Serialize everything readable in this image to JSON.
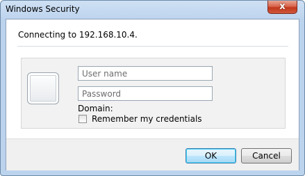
{
  "window": {
    "title": "Windows Security",
    "close_label": "x"
  },
  "dialog": {
    "message": "Connecting to 192.168.10.4.",
    "username_placeholder": "User name",
    "password_placeholder": "Password",
    "domain_label": "Domain:",
    "remember_label": "Remember my credentials",
    "remember_checked": false
  },
  "buttons": {
    "ok": "OK",
    "cancel": "Cancel"
  }
}
